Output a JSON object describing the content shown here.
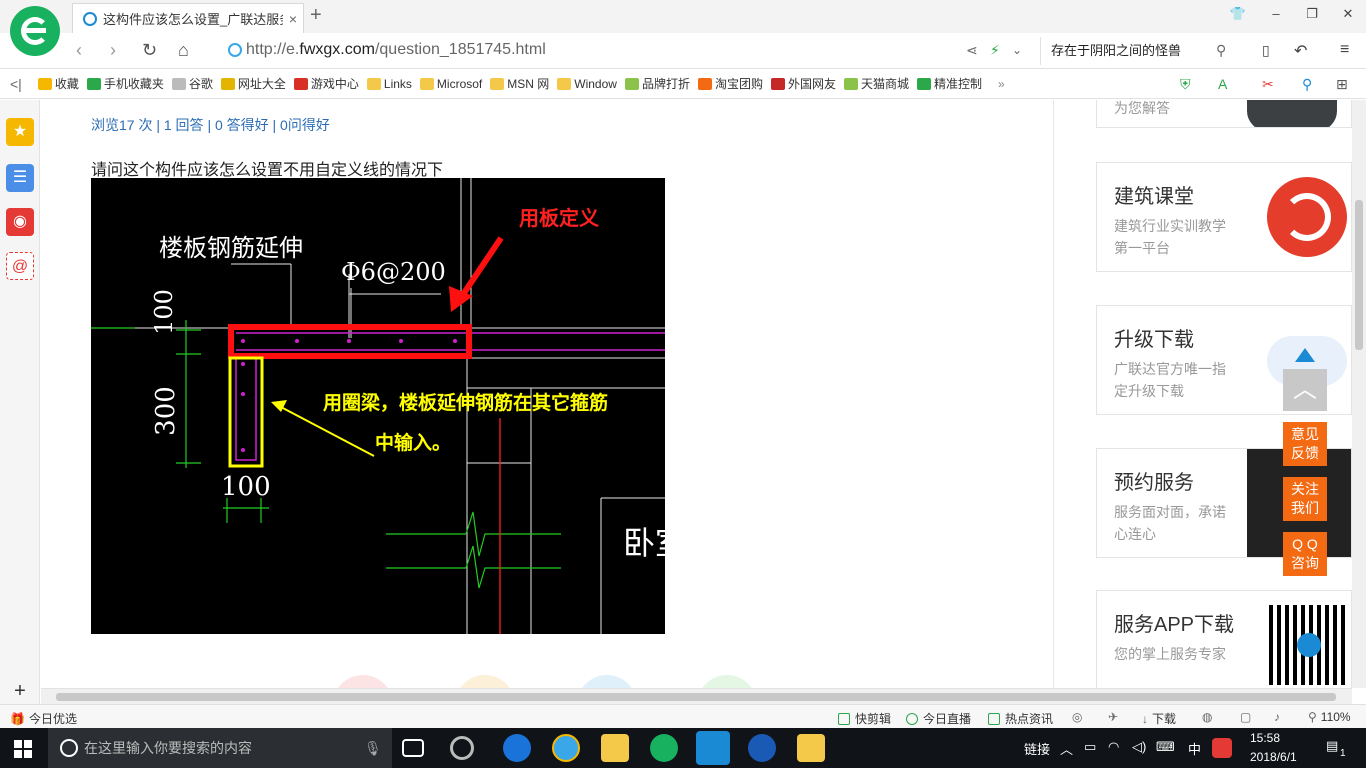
{
  "browser": {
    "tab_title": "这构件应该怎么设置_广联达服务",
    "tab_close": "×",
    "new_tab": "+",
    "url_prefix": "http://e.",
    "url_domain": "fwxgx.com",
    "url_path": "/question_1851745.html",
    "search_text": "存在于阴阳之间的怪兽",
    "window_controls": {
      "skin": "👕",
      "minimize": "–",
      "restore": "❐",
      "close": "✕"
    }
  },
  "bookmarks": [
    {
      "label": "收藏",
      "icon": "star-icon",
      "color": "#f5b700"
    },
    {
      "label": "手机收藏夹",
      "icon": "phone-icon",
      "color": "#2aa84a"
    },
    {
      "label": "谷歌",
      "icon": "page-icon",
      "color": "#bbbbbb"
    },
    {
      "label": "网址大全",
      "icon": "globe-icon",
      "color": "#e3b400"
    },
    {
      "label": "游戏中心",
      "icon": "game-icon",
      "color": "#d93025"
    },
    {
      "label": "Links",
      "icon": "folder-icon",
      "color": "#f4c94a"
    },
    {
      "label": "Microsof",
      "icon": "folder-icon",
      "color": "#f4c94a"
    },
    {
      "label": "MSN 网",
      "icon": "folder-icon",
      "color": "#f4c94a"
    },
    {
      "label": "Window",
      "icon": "folder-icon",
      "color": "#f4c94a"
    },
    {
      "label": "品牌打折",
      "icon": "leaf-icon",
      "color": "#8bc34a"
    },
    {
      "label": "淘宝团购",
      "icon": "taobao-icon",
      "color": "#f36a12"
    },
    {
      "label": "外国网友",
      "icon": "bookmark-icon",
      "color": "#c62828"
    },
    {
      "label": "天猫商城",
      "icon": "leaf-icon",
      "color": "#8bc34a"
    },
    {
      "label": "精准控制",
      "icon": "chat-icon",
      "color": "#2aa84a"
    }
  ],
  "bookmarks_more": "»",
  "page": {
    "stats": "浏览17 次 | 1 回答 | 0 答得好 | 0问得好",
    "question": "请问这个构件应该怎么设置不用自定义线的情况下",
    "cad": {
      "label_floor_ext": "楼板钢筋延伸",
      "label_rebar": "Φ6@200",
      "dim_100_top": "100",
      "dim_300": "300",
      "dim_100_bottom": "100",
      "annotation_red": "用板定义",
      "annotation_yellow_1": "用圈梁，楼板延伸钢筋在其它箍筋",
      "annotation_yellow_2": "中输入。",
      "room_label": "卧室"
    }
  },
  "side_cards": [
    {
      "title": "",
      "sub": "为您解答"
    },
    {
      "title": "建筑课堂",
      "sub": "建筑行业实训教学第一平台"
    },
    {
      "title": "升级下载",
      "sub": "广联达官方唯一指定升级下载"
    },
    {
      "title": "预约服务",
      "sub": "服务面对面，承诺心连心"
    },
    {
      "title": "服务APP下载",
      "sub": "您的掌上服务专家"
    }
  ],
  "float_buttons": {
    "to_top": "︿",
    "feedback": "意见\n反馈",
    "follow": "关注\n我们",
    "qq": "Q Q\n咨询"
  },
  "statusbar": {
    "left": "今日优选",
    "items": [
      "快剪辑",
      "今日直播",
      "热点资讯"
    ],
    "download": "下载",
    "zoom": "110%"
  },
  "taskbar": {
    "search_placeholder": "在这里输入你要搜索的内容",
    "link_label": "链接",
    "ime": "中",
    "time": "15:58",
    "date": "2018/6/1",
    "notification_count": "1"
  },
  "colors": {
    "accent_blue": "#2d6db5",
    "orange": "#f36a12",
    "brand_green": "#17b15f"
  }
}
